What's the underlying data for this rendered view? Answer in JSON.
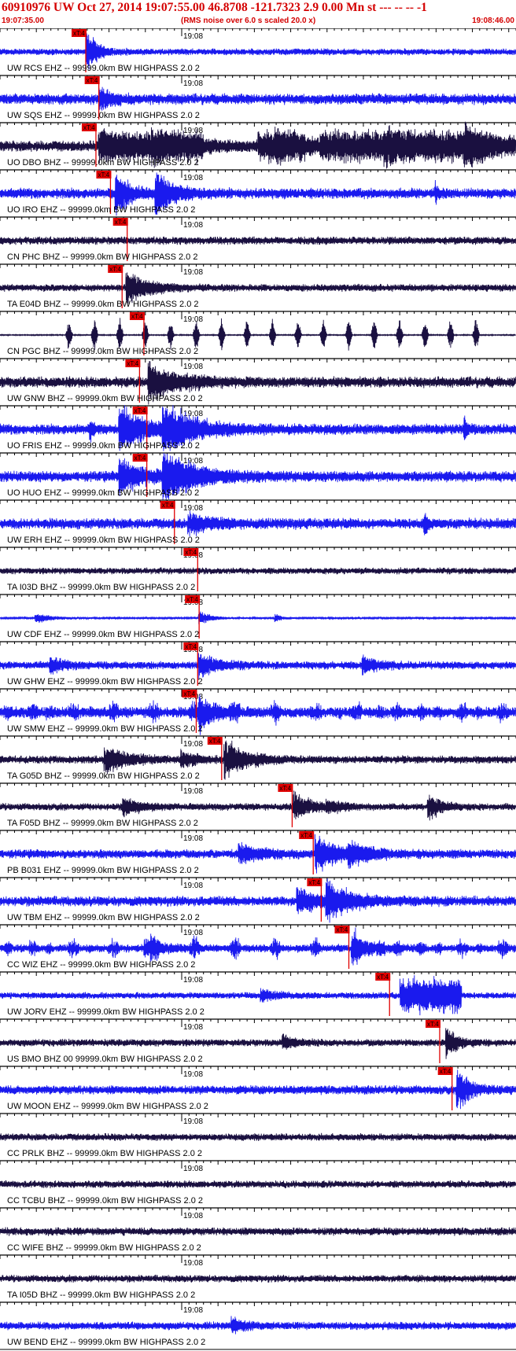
{
  "header": {
    "title": "60910976 UW Oct 27, 2014 19:07:55.00   46.8708 -121.7323  2.9 0.00 Mn st --- -- --   -1",
    "start_time": "19:07:35.00",
    "scale_note": "(RMS noise over 6.0 s scaled 20.0 x)",
    "end_time": "19:08:46.00"
  },
  "chart_data": {
    "type": "line",
    "title": "60910976 UW Oct 27, 2014 19:07:55.00   46.8708 -121.7323  2.9 0.00 Mn st --- -- --   -1",
    "x_range": [
      "19:07:35.00",
      "19:08:46.00"
    ],
    "x_range_seconds": [
      0,
      71
    ],
    "minute_tick_label": "19:08",
    "minute_tick_seconds": 25,
    "pick_label": "xT:4",
    "grid": true,
    "colors": {
      "blue": "#1a1aee",
      "dark": "#1a1040",
      "pick": "#e00000",
      "header": "#d40000"
    },
    "series": [
      {
        "label": "UW RCS EHZ -- 99999.0km BW  HIGHPASS  2.0  2",
        "color": "#1a1aee",
        "pick_s": 11.8,
        "amp": 0.18,
        "events": [
          [
            12,
            1,
            1.5
          ]
        ]
      },
      {
        "label": "UW SQS EHZ -- 99999.0km BW  HIGHPASS  2.0  2",
        "color": "#1a1aee",
        "pick_s": 13.6,
        "amp": 0.3,
        "events": [
          [
            13.8,
            0.6,
            1.5
          ]
        ]
      },
      {
        "label": "UO DBO BHZ -- 99999.0km BW  HIGHPASS  2.0  2",
        "color": "#1a1040",
        "pick_s": 13.2,
        "amp": 0.3,
        "events": [
          [
            14,
            1,
            2.5
          ],
          [
            21,
            1,
            5
          ],
          [
            38,
            1,
            4
          ],
          [
            53,
            1,
            9
          ],
          [
            64,
            1,
            4
          ]
        ],
        "blocks": [
          [
            13.5,
            28,
            0.9
          ],
          [
            35.5,
            42,
            0.9
          ],
          [
            44,
            67,
            0.9
          ]
        ]
      },
      {
        "label": "UO IRO EHZ -- 99999.0km BW  HIGHPASS  2.0  2",
        "color": "#1a1aee",
        "pick_s": 15.2,
        "amp": 0.3,
        "events": [
          [
            16,
            1.4,
            1.5
          ],
          [
            21.5,
            1.3,
            2
          ],
          [
            60,
            0.4,
            0.3
          ]
        ]
      },
      {
        "label": "CN PHC BHZ -- 99999.0km BW  HIGHPASS  2.0  2",
        "color": "#1a1040",
        "pick_s": 17.5,
        "amp": 0.22,
        "events": []
      },
      {
        "label": "TA E04D BHZ -- 99999.0km BW  HIGHPASS  2.0  2",
        "color": "#1a1040",
        "pick_s": 16.8,
        "amp": 0.2,
        "events": [
          [
            17.5,
            0.9,
            3
          ]
        ]
      },
      {
        "label": "CN PGC BHZ -- 99999.0km BW  HIGHPASS  2.0  2",
        "color": "#1a1040",
        "pick_s": 19.8,
        "amp": 0.03,
        "events": [],
        "spikes": [
          9.5,
          13,
          16.5,
          20,
          23.5,
          27,
          30.5,
          34,
          37.5,
          41,
          44.5,
          48,
          51.5,
          55,
          58.5,
          62,
          65.5
        ]
      },
      {
        "label": "UW GNW BHZ -- 99999.0km BW  HIGHPASS  2.0  2",
        "color": "#1a1040",
        "pick_s": 19.2,
        "amp": 0.3,
        "events": [
          [
            20.5,
            1,
            4
          ]
        ]
      },
      {
        "label": "UO FRIS EHZ -- 99999.0km BW  HIGHPASS  2.0  2",
        "color": "#1a1aee",
        "pick_s": 20.2,
        "amp": 0.3,
        "events": [
          [
            16.5,
            1.3,
            3
          ],
          [
            22.5,
            1.4,
            4
          ],
          [
            12.5,
            0.4,
            0.5
          ],
          [
            64,
            0.6,
            0.4
          ]
        ]
      },
      {
        "label": "UO HUO EHZ -- 99999.0km BW  HIGHPASS  2.0  2",
        "color": "#1a1aee",
        "pick_s": 20.2,
        "amp": 0.3,
        "events": [
          [
            16.5,
            1,
            3
          ],
          [
            22.5,
            1.5,
            4
          ]
        ]
      },
      {
        "label": "UW ERH EHZ -- 99999.0km BW  HIGHPASS  2.0  2",
        "color": "#1a1aee",
        "pick_s": 24.0,
        "amp": 0.3,
        "events": [
          [
            26,
            0.5,
            3
          ],
          [
            58.5,
            0.7,
            0.4
          ]
        ]
      },
      {
        "label": "TA I03D BHZ -- 99999.0km BW  HIGHPASS  2.0  2",
        "color": "#1a1040",
        "pick_s": 27.2,
        "amp": 0.18,
        "events": []
      },
      {
        "label": "UW CDF EHZ -- 99999.0km BW  HIGHPASS  2.0  2",
        "color": "#1a1aee",
        "pick_s": 27.4,
        "amp": 0.05,
        "events": [
          [
            5,
            0.3,
            2
          ],
          [
            27.5,
            0.4,
            1.5
          ],
          [
            38,
            0.2,
            0.8
          ]
        ]
      },
      {
        "label": "UW GHW EHZ -- 99999.0km BW  HIGHPASS  2.0  2",
        "color": "#1a1aee",
        "pick_s": 27.2,
        "amp": 0.22,
        "events": [
          [
            7,
            0.5,
            1.5
          ],
          [
            27.5,
            0.6,
            2.5
          ],
          [
            50,
            0.4,
            2
          ]
        ]
      },
      {
        "label": "UW SMW EHZ -- 99999.0km BW  HIGHPASS  2.0  2",
        "color": "#1a1aee",
        "pick_s": 27.0,
        "amp": 0.3,
        "events": [
          [
            27.5,
            0.9,
            2
          ]
        ],
        "bursts": true
      },
      {
        "label": "TA G05D BHZ -- 99999.0km BW  HIGHPASS  2.0  2",
        "color": "#1a1040",
        "pick_s": 30.5,
        "amp": 0.22,
        "events": [
          [
            14.5,
            0.7,
            3
          ],
          [
            31,
            1,
            3
          ],
          [
            25,
            0.4,
            2
          ]
        ]
      },
      {
        "label": "TA F05D BHZ -- 99999.0km BW  HIGHPASS  2.0  2",
        "color": "#1a1040",
        "pick_s": 40.2,
        "amp": 0.2,
        "events": [
          [
            17,
            0.5,
            2
          ],
          [
            40.5,
            0.8,
            2
          ],
          [
            59,
            0.7,
            1.5
          ],
          [
            45,
            0.3,
            2
          ]
        ]
      },
      {
        "label": "PB B031 EHZ -- 99999.0km BW  HIGHPASS  2.0  2",
        "color": "#1a1aee",
        "pick_s": 43.1,
        "amp": 0.25,
        "events": [
          [
            33,
            0.5,
            3
          ],
          [
            43.5,
            1,
            3
          ],
          [
            48,
            0.5,
            3
          ]
        ]
      },
      {
        "label": "UW TBM EHZ -- 99999.0km BW  HIGHPASS  2.0  2",
        "color": "#1a1aee",
        "pick_s": 44.2,
        "amp": 0.28,
        "events": [
          [
            41,
            0.6,
            3
          ],
          [
            45,
            1,
            3
          ]
        ]
      },
      {
        "label": "CC WIZ EHZ -- 99999.0km BW  HIGHPASS  2.0  2",
        "color": "#1a1aee",
        "pick_s": 48.0,
        "amp": 0.22,
        "events": [
          [
            48.5,
            0.7,
            2.5
          ],
          [
            20,
            0.4,
            3
          ]
        ],
        "bursts": true
      },
      {
        "label": "UW JORV EHZ -- 99999.0km BW  HIGHPASS  2.0  2",
        "color": "#1a1aee",
        "pick_s": 53.6,
        "amp": 0.18,
        "events": [
          [
            36,
            0.3,
            2
          ]
        ],
        "blocks": [
          [
            55,
            63.5,
            1
          ]
        ]
      },
      {
        "label": "US BMO BHZ 00 99999.0km BW  HIGHPASS  2.0  2",
        "color": "#1a1040",
        "pick_s": 60.5,
        "amp": 0.2,
        "events": [
          [
            61.5,
            1,
            1.2
          ],
          [
            39,
            0.4,
            1.5
          ]
        ]
      },
      {
        "label": "UW MOON EHZ -- 99999.0km BW  HIGHPASS  2.0  2",
        "color": "#1a1aee",
        "pick_s": 62.2,
        "amp": 0.25,
        "events": [
          [
            63,
            1.3,
            1.5
          ]
        ]
      },
      {
        "label": "CC PRLK BHZ -- 99999.0km BW  HIGHPASS  2.0  2",
        "color": "#1a1040",
        "pick_s": null,
        "amp": 0.2,
        "events": []
      },
      {
        "label": "CC TCBU BHZ -- 99999.0km BW  HIGHPASS  2.0  2",
        "color": "#1a1040",
        "pick_s": null,
        "amp": 0.2,
        "events": []
      },
      {
        "label": "CC WIFE BHZ -- 99999.0km BW  HIGHPASS  2.0  2",
        "color": "#1a1040",
        "pick_s": null,
        "amp": 0.22,
        "events": []
      },
      {
        "label": "TA I05D BHZ -- 99999.0km BW  HIGHPASS  2.0  2",
        "color": "#1a1040",
        "pick_s": null,
        "amp": 0.2,
        "events": []
      },
      {
        "label": "UW BEND EHZ -- 99999.0km BW  HIGHPASS  2.0  2",
        "color": "#1a1aee",
        "pick_s": null,
        "amp": 0.22,
        "events": [
          [
            32,
            0.4,
            1.5
          ]
        ]
      }
    ]
  }
}
